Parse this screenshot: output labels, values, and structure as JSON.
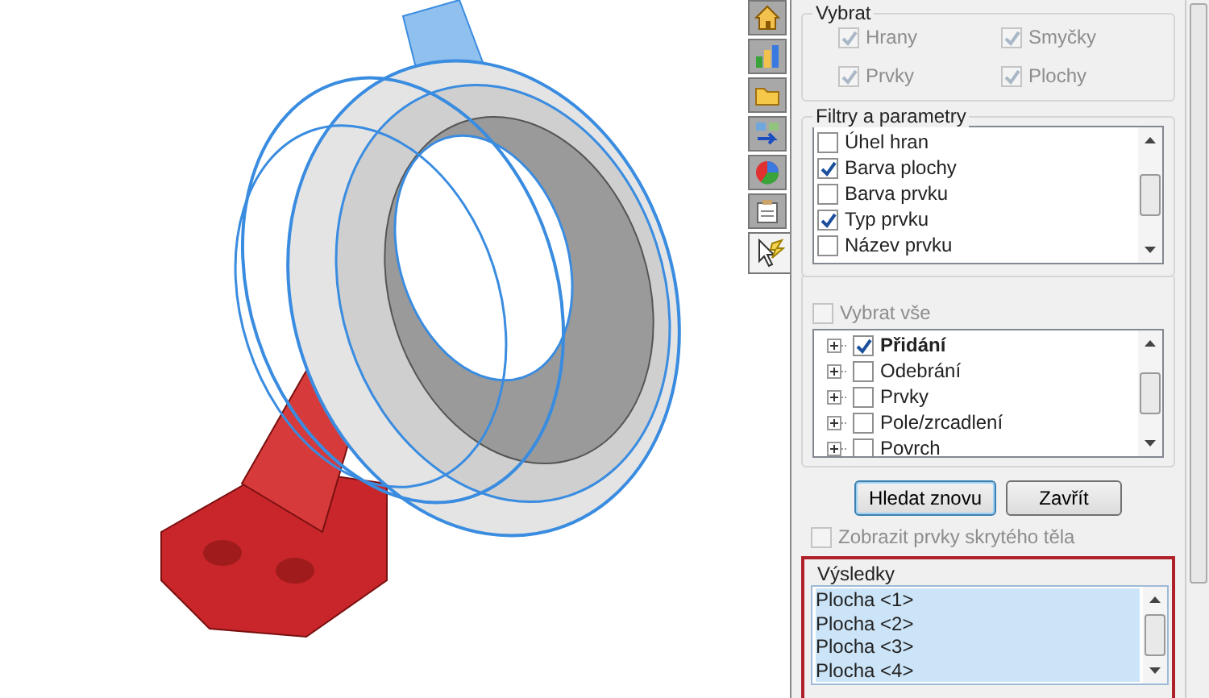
{
  "side_tabs": [
    {
      "kind": "home",
      "selected": false
    },
    {
      "kind": "chart",
      "selected": false
    },
    {
      "kind": "folder",
      "selected": false
    },
    {
      "kind": "transfer",
      "selected": false
    },
    {
      "kind": "appearance",
      "selected": false
    },
    {
      "kind": "clipboard",
      "selected": false
    },
    {
      "kind": "select",
      "selected": true
    }
  ],
  "select_group": {
    "title": "Vybrat",
    "options": [
      {
        "label": "Hrany",
        "checked": true,
        "disabled": true
      },
      {
        "label": "Smyčky",
        "checked": true,
        "disabled": true
      },
      {
        "label": "Prvky",
        "checked": true,
        "disabled": true
      },
      {
        "label": "Plochy",
        "checked": true,
        "disabled": true
      }
    ]
  },
  "filters": {
    "title": "Filtry a parametry",
    "items": [
      {
        "label": "Úhel hran",
        "checked": false
      },
      {
        "label": "Barva plochy",
        "checked": true
      },
      {
        "label": "Barva prvku",
        "checked": false
      },
      {
        "label": "Typ prvku",
        "checked": true
      },
      {
        "label": "Název prvku",
        "checked": false
      }
    ]
  },
  "select_all": {
    "label": "Vybrat vše",
    "checked": false,
    "disabled": true
  },
  "tree": {
    "items": [
      {
        "label": "Přidání",
        "checked": true,
        "bold": true
      },
      {
        "label": "Odebrání",
        "checked": false,
        "bold": false
      },
      {
        "label": "Prvky",
        "checked": false,
        "bold": false
      },
      {
        "label": "Pole/zrcadlení",
        "checked": false,
        "bold": false
      },
      {
        "label": "Povrch",
        "checked": false,
        "bold": false
      }
    ]
  },
  "buttons": [
    {
      "label": "Hledat znovu",
      "default": true
    },
    {
      "label": "Zavřít",
      "default": false
    }
  ],
  "show_hidden": {
    "label": "Zobrazit prvky skrytého těla",
    "checked": false,
    "disabled": true
  },
  "results": {
    "title": "Výsledky",
    "items": [
      {
        "label": "Plocha <1>",
        "selected": true
      },
      {
        "label": "Plocha <2>",
        "selected": true
      },
      {
        "label": "Plocha <3>",
        "selected": true
      },
      {
        "label": "Plocha <4>",
        "selected": true
      }
    ]
  }
}
